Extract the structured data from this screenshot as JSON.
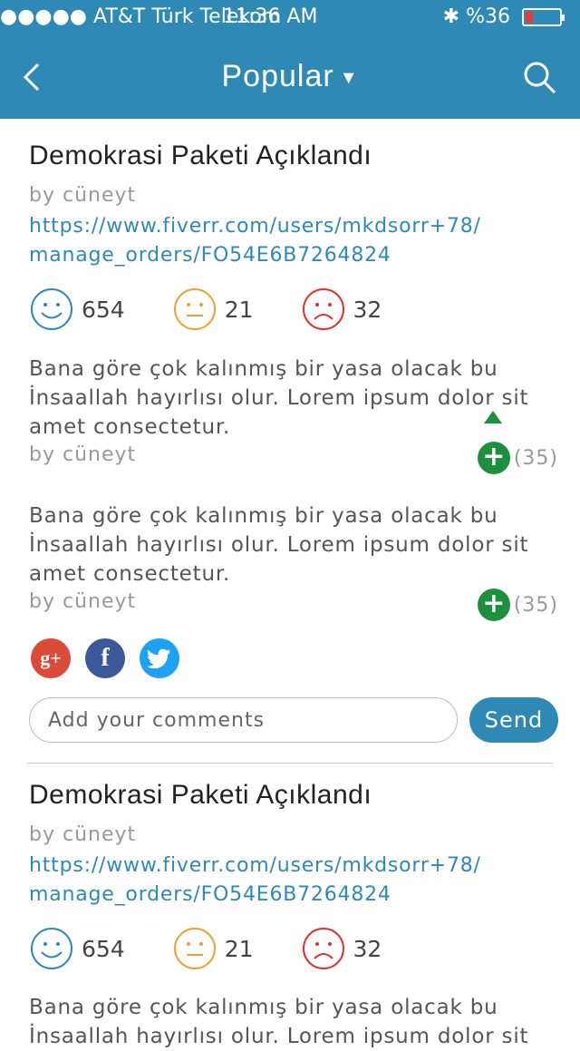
{
  "status_bar": {
    "left": "●●●●● AT&T Türk Telekom",
    "time": "11:36 AM",
    "right": "%36"
  },
  "nav": {
    "title": "Popular",
    "caret": "▼"
  },
  "posts": [
    {
      "title": "Demokrasi Paketi Açıklandı",
      "author": "by cüneyt",
      "link_line1": "https://www.fiverr.com/users/mkdsorr+78/",
      "link_line2": "manage_orders/FO54E6B7264824",
      "reactions": {
        "happy": "654",
        "neutral": "21",
        "sad": "32"
      },
      "comments": [
        {
          "line1": "Bana göre çok kalınmış bir yasa olacak bu",
          "line2": "İnsaallah hayırlısı olur. Lorem ipsum dolor sit",
          "line3": "amet consectetur.",
          "author": "by cüneyt",
          "plus": "+",
          "votes": "(35)"
        },
        {
          "line1": "Bana göre çok kalınmış bir yasa olacak bu",
          "line2": "İnsaallah hayırlısı olur. Lorem ipsum dolor sit",
          "line3": "amet consectetur.",
          "author": "by cüneyt",
          "plus": "+",
          "votes": "(35)"
        }
      ],
      "share": {
        "gplus": "g+",
        "facebook": "f"
      },
      "comment_box": {
        "placeholder": "Add your comments",
        "send_label": "Send"
      }
    },
    {
      "title": "Demokrasi Paketi Açıklandı",
      "author": "by cüneyt",
      "link_line1": "https://www.fiverr.com/users/mkdsorr+78/",
      "link_line2": "manage_orders/FO54E6B7264824",
      "reactions": {
        "happy": "654",
        "neutral": "21",
        "sad": "32"
      },
      "comments": [
        {
          "line1": "Bana göre çok kalınmış bir yasa olacak bu",
          "line2": "İnsaallah hayırlısı olur. Lorem ipsum dolor sit"
        }
      ]
    }
  ],
  "colors": {
    "header": "#2e8ab5",
    "happy": "#2e8ab5",
    "neutral": "#f0a030",
    "sad": "#e03030",
    "vote": "#1e8f3e"
  }
}
